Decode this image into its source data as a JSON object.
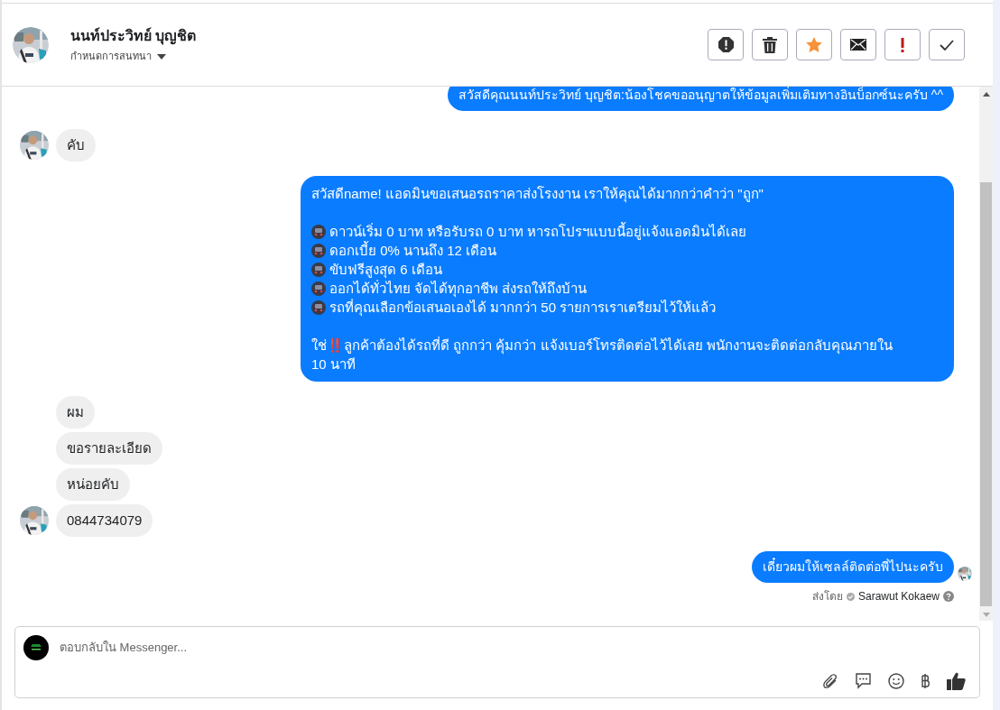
{
  "contact": {
    "name": "นนท์ประวิทย์ บุญชิต",
    "status": "กำหนดการสนทนา"
  },
  "actions": [
    {
      "kind": "alert"
    },
    {
      "kind": "trash"
    },
    {
      "kind": "star"
    },
    {
      "kind": "mail"
    },
    {
      "kind": "exclaim"
    },
    {
      "kind": "check"
    }
  ],
  "messages": [
    {
      "kind": "page",
      "seen": false,
      "text": "สวัสดีคุณนนท์ประวิทย์ บุญชิต:น้องโชคขออนุญาตให้ข้อมูลเพิ่มเติมทางอินบ็อกซ์นะครับ ^^"
    },
    {
      "kind": "contact",
      "avatar": true,
      "text": "คับ"
    },
    {
      "kind": "page",
      "seen": false,
      "lines": [
        {
          "kind": "text",
          "text": "สวัสดีname! แอดมินขอเสนอรถราคาส่งโรงงาน เราให้คุณได้มากกว่าคำว่า \"ถูก\""
        },
        {
          "kind": "blank"
        },
        {
          "kind": "bullet",
          "text": "ดาวน์เริ่ม 0 บาท หรือรับรถ 0 บาท หารถโปรฯแบบนี้อยู่แจ้งแอดมินได้เลย"
        },
        {
          "kind": "bullet",
          "text": "ดอกเบี้ย 0% นานถึง 12 เดือน"
        },
        {
          "kind": "bullet",
          "text": "ขับฟรีสูงสุด 6 เดือน"
        },
        {
          "kind": "bullet",
          "text": "ออกได้ทั่วไทย จัดได้ทุกอาชีพ ส่งรถให้ถึงบ้าน"
        },
        {
          "kind": "bullet",
          "text": "รถที่คุณเลือกข้อเสนอเองได้ มากกว่า 50 รายการเราเตรียมไว้ให้แล้ว"
        },
        {
          "kind": "blank"
        },
        {
          "kind": "text",
          "text": "ใช่‼️ลูกค้าต้องได้รถที่ดี ถูกกว่า คุ้มกว่า แจ้งเบอร์โทรติดต่อไว้ได้เลย พนักงานจะติดต่อกลับคุณภายใน 10 นาที"
        }
      ]
    },
    {
      "kind": "contact",
      "avatar": false,
      "text": "ผม"
    },
    {
      "kind": "contact",
      "avatar": false,
      "text": "ขอรายละเอียด"
    },
    {
      "kind": "contact",
      "avatar": false,
      "text": "หน่อยคับ"
    },
    {
      "kind": "contact",
      "avatar": true,
      "text": "0844734079"
    },
    {
      "kind": "page",
      "text": "เดี๋ยวผมให้เซลล์ติดต่อพี่ไปนะครับ",
      "seen": true,
      "sent_by": {
        "label": "ส่งโดย",
        "name": "Sarawut Kokaew"
      }
    }
  ],
  "composer": {
    "placeholder": "ตอบกลับใน Messenger...",
    "tools": [
      {
        "kind": "attach"
      },
      {
        "kind": "reply"
      },
      {
        "kind": "emoji"
      },
      {
        "kind": "baht"
      },
      {
        "kind": "like"
      }
    ]
  }
}
